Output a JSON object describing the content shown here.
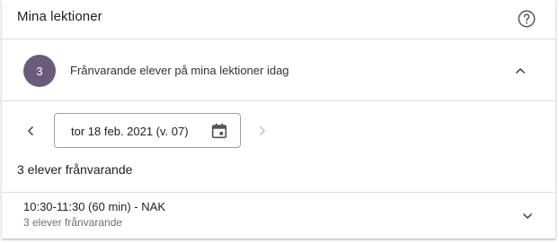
{
  "header": {
    "title": "Mina lektioner",
    "help_icon": "help-circle-icon"
  },
  "summary": {
    "count": "3",
    "text": "Frånvarande elever på mina lektioner idag",
    "badge_color": "#6b5b7b",
    "collapse_icon": "chevron-up-icon"
  },
  "date_nav": {
    "prev_icon": "chevron-left-icon",
    "next_icon": "chevron-right-icon",
    "date_value": "tor 18 feb. 2021 (v. 07)",
    "calendar_icon": "calendar-icon"
  },
  "absent_summary": "3 elever frånvarande",
  "lessons": [
    {
      "title": "10:30-11:30 (60 min) - NAK",
      "subtitle": "3 elever frånvarande",
      "expand_icon": "chevron-down-icon"
    }
  ]
}
